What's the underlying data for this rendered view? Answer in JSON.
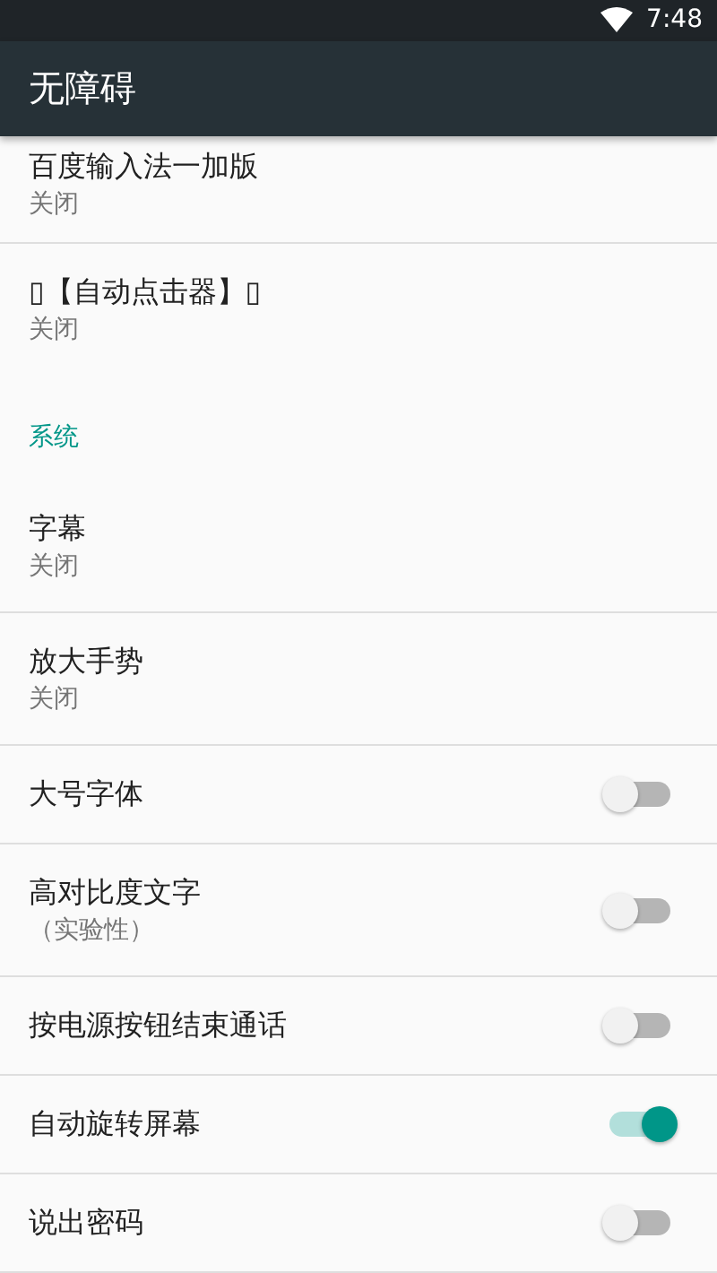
{
  "status_bar": {
    "time": "7:48"
  },
  "toolbar": {
    "title": "无障碍"
  },
  "items": [
    {
      "kind": "summary",
      "title": "百度输入法一加版",
      "summary": "关闭",
      "cut": true
    },
    {
      "kind": "summary",
      "title": "▯【自动点击器】▯",
      "summary": "关闭"
    },
    {
      "kind": "category",
      "title": "系统"
    },
    {
      "kind": "summary",
      "title": "字幕",
      "summary": "关闭"
    },
    {
      "kind": "summary",
      "title": "放大手势",
      "summary": "关闭"
    },
    {
      "kind": "switch",
      "title": "大号字体",
      "on": false
    },
    {
      "kind": "switch",
      "title": "高对比度文字",
      "summary": "（实验性）",
      "on": false
    },
    {
      "kind": "switch",
      "title": "按电源按钮结束通话",
      "on": false
    },
    {
      "kind": "switch",
      "title": "自动旋转屏幕",
      "on": true
    },
    {
      "kind": "switch",
      "title": "说出密码",
      "on": false
    }
  ]
}
